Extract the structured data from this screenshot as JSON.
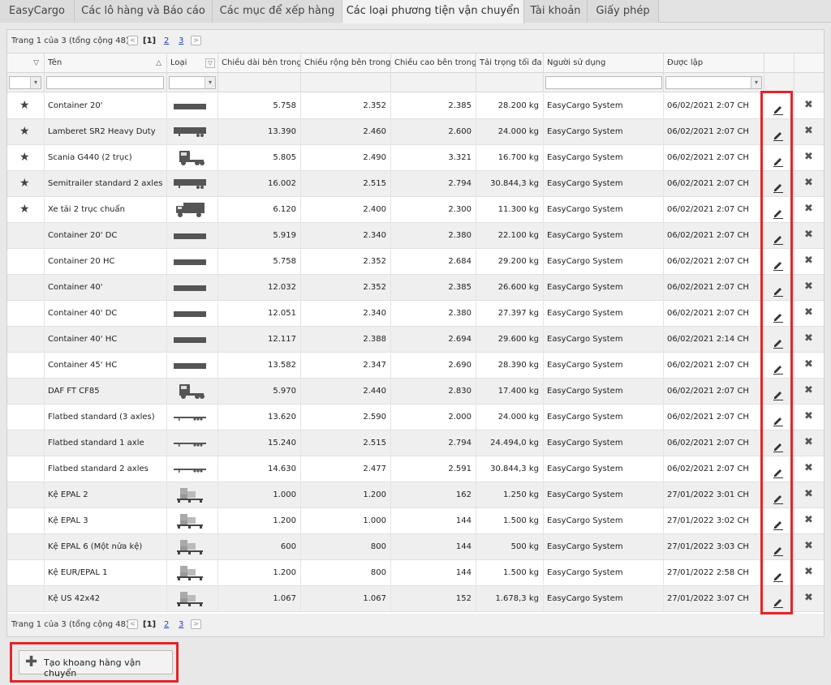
{
  "tabs": [
    {
      "label": "EasyCargo",
      "active": false
    },
    {
      "label": "Các lô hàng và Báo cáo",
      "active": false
    },
    {
      "label": "Các mục để xếp hàng",
      "active": false
    },
    {
      "label": "Các loại phương tiện vận chuyển",
      "active": true
    },
    {
      "label": "Tài khoản",
      "active": false
    },
    {
      "label": "Giấy phép",
      "active": false
    }
  ],
  "pager": {
    "info": "Trang 1 của 3 (tổng cộng 48)",
    "prev": "<",
    "current": "[1]",
    "page2": "2",
    "page3": "3",
    "next": ">"
  },
  "columns": {
    "name": "Tên",
    "type": "Loại",
    "length": "Chiều dài bên trong",
    "width": "Chiều rộng bên trong",
    "height": "Chiều cao bên trong",
    "payload": "Tải trọng tối đa",
    "user": "Người sử dụng",
    "created": "Được lập"
  },
  "rows": [
    {
      "fav": true,
      "name": "Container 20'",
      "icon": "container",
      "length": "5.758",
      "width": "2.352",
      "height": "2.385",
      "payload": "28.200 kg",
      "user": "EasyCargo System",
      "created": "06/02/2021 2:07 CH"
    },
    {
      "fav": true,
      "name": "Lamberet SR2 Heavy Duty",
      "icon": "semitrailer",
      "length": "13.390",
      "width": "2.460",
      "height": "2.600",
      "payload": "24.000 kg",
      "user": "EasyCargo System",
      "created": "06/02/2021 2:07 CH"
    },
    {
      "fav": true,
      "name": "Scania G440 (2 trục)",
      "icon": "tractor",
      "length": "5.805",
      "width": "2.490",
      "height": "3.321",
      "payload": "16.700 kg",
      "user": "EasyCargo System",
      "created": "06/02/2021 2:07 CH"
    },
    {
      "fav": true,
      "name": "Semitrailer standard 2 axles",
      "icon": "semitrailer",
      "length": "16.002",
      "width": "2.515",
      "height": "2.794",
      "payload": "30.844,3 kg",
      "user": "EasyCargo System",
      "created": "06/02/2021 2:07 CH"
    },
    {
      "fav": true,
      "name": "Xe tải 2 trục chuẩn",
      "icon": "truck",
      "length": "6.120",
      "width": "2.400",
      "height": "2.300",
      "payload": "11.300 kg",
      "user": "EasyCargo System",
      "created": "06/02/2021 2:07 CH"
    },
    {
      "fav": false,
      "name": "Container 20' DC",
      "icon": "container",
      "length": "5.919",
      "width": "2.340",
      "height": "2.380",
      "payload": "22.100 kg",
      "user": "EasyCargo System",
      "created": "06/02/2021 2:07 CH"
    },
    {
      "fav": false,
      "name": "Container 20 HC",
      "icon": "container",
      "length": "5.758",
      "width": "2.352",
      "height": "2.684",
      "payload": "29.200 kg",
      "user": "EasyCargo System",
      "created": "06/02/2021 2:07 CH"
    },
    {
      "fav": false,
      "name": "Container 40'",
      "icon": "container",
      "length": "12.032",
      "width": "2.352",
      "height": "2.385",
      "payload": "26.600 kg",
      "user": "EasyCargo System",
      "created": "06/02/2021 2:07 CH"
    },
    {
      "fav": false,
      "name": "Container 40' DC",
      "icon": "container",
      "length": "12.051",
      "width": "2.340",
      "height": "2.380",
      "payload": "27.397 kg",
      "user": "EasyCargo System",
      "created": "06/02/2021 2:07 CH"
    },
    {
      "fav": false,
      "name": "Container 40' HC",
      "icon": "container",
      "length": "12.117",
      "width": "2.388",
      "height": "2.694",
      "payload": "29.600 kg",
      "user": "EasyCargo System",
      "created": "06/02/2021 2:14 CH"
    },
    {
      "fav": false,
      "name": "Container 45' HC",
      "icon": "container",
      "length": "13.582",
      "width": "2.347",
      "height": "2.690",
      "payload": "28.390 kg",
      "user": "EasyCargo System",
      "created": "06/02/2021 2:07 CH"
    },
    {
      "fav": false,
      "name": "DAF FT CF85",
      "icon": "tractor",
      "length": "5.970",
      "width": "2.440",
      "height": "2.830",
      "payload": "17.400 kg",
      "user": "EasyCargo System",
      "created": "06/02/2021 2:07 CH"
    },
    {
      "fav": false,
      "name": "Flatbed standard (3 axles)",
      "icon": "flatbed",
      "length": "13.620",
      "width": "2.590",
      "height": "2.000",
      "payload": "24.000 kg",
      "user": "EasyCargo System",
      "created": "06/02/2021 2:07 CH"
    },
    {
      "fav": false,
      "name": "Flatbed standard 1 axle",
      "icon": "flatbed",
      "length": "15.240",
      "width": "2.515",
      "height": "2.794",
      "payload": "24.494,0 kg",
      "user": "EasyCargo System",
      "created": "06/02/2021 2:07 CH"
    },
    {
      "fav": false,
      "name": "Flatbed standard 2 axles",
      "icon": "flatbed",
      "length": "14.630",
      "width": "2.477",
      "height": "2.591",
      "payload": "30.844,3 kg",
      "user": "EasyCargo System",
      "created": "06/02/2021 2:07 CH"
    },
    {
      "fav": false,
      "name": "Kệ EPAL 2",
      "icon": "pallet",
      "length": "1.000",
      "width": "1.200",
      "height": "162",
      "payload": "1.250 kg",
      "user": "EasyCargo System",
      "created": "27/01/2022 3:01 CH"
    },
    {
      "fav": false,
      "name": "Kệ EPAL 3",
      "icon": "pallet",
      "length": "1.200",
      "width": "1.000",
      "height": "144",
      "payload": "1.500 kg",
      "user": "EasyCargo System",
      "created": "27/01/2022 3:02 CH"
    },
    {
      "fav": false,
      "name": "Kệ EPAL 6 (Một nửa kệ)",
      "icon": "pallet",
      "length": "600",
      "width": "800",
      "height": "144",
      "payload": "500 kg",
      "user": "EasyCargo System",
      "created": "27/01/2022 3:03 CH"
    },
    {
      "fav": false,
      "name": "Kệ EUR/EPAL 1",
      "icon": "pallet",
      "length": "1.200",
      "width": "800",
      "height": "144",
      "payload": "1.500 kg",
      "user": "EasyCargo System",
      "created": "27/01/2022 2:58 CH"
    },
    {
      "fav": false,
      "name": "Kệ US 42x42",
      "icon": "pallet",
      "length": "1.067",
      "width": "1.067",
      "height": "152",
      "payload": "1.678,3 kg",
      "user": "EasyCargo System",
      "created": "27/01/2022 3:07 CH"
    }
  ],
  "create_button": {
    "label": "Tạo khoang hàng vận chuyển"
  },
  "colors": {
    "highlight": "#e0262b",
    "link": "#2244bb"
  }
}
